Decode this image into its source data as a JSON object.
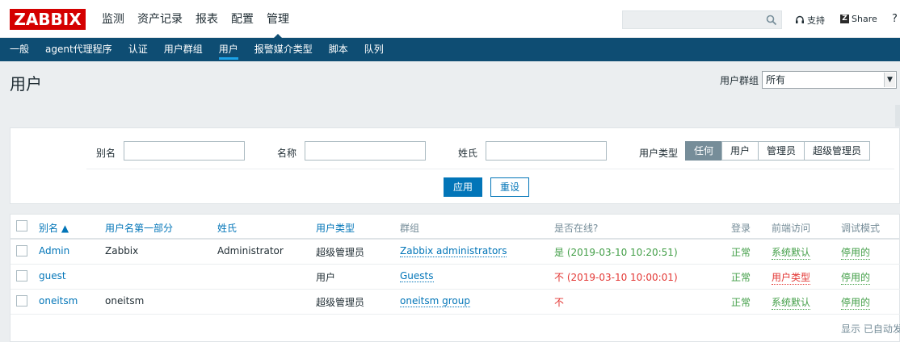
{
  "header": {
    "logo": "ZABBIX",
    "menu": [
      "监测",
      "资产记录",
      "报表",
      "配置",
      "管理"
    ],
    "selected_menu": 4,
    "search_placeholder": "",
    "support_label": "支持",
    "share_label": "Share",
    "share_icon_letter": "Z",
    "help_label": "?"
  },
  "subnav": {
    "items": [
      "一般",
      "agent代理程序",
      "认证",
      "用户群组",
      "用户",
      "报警媒介类型",
      "脚本",
      "队列"
    ],
    "selected": 4
  },
  "page": {
    "title": "用户",
    "group_filter_label": "用户群组",
    "group_filter_value": "所有"
  },
  "filter": {
    "alias_label": "别名",
    "name_label": "名称",
    "surname_label": "姓氏",
    "usertype_label": "用户类型",
    "usertype_options": [
      "任何",
      "用户",
      "管理员",
      "超级管理员"
    ],
    "usertype_selected": 0,
    "apply_label": "应用",
    "reset_label": "重设"
  },
  "table": {
    "columns": [
      "别名 ▲",
      "用户名第一部分",
      "姓氏",
      "用户类型",
      "群组",
      "是否在线?",
      "登录",
      "前端访问",
      "调试模式"
    ],
    "rows": [
      {
        "alias": "Admin",
        "name": "Zabbix",
        "surname": "Administrator",
        "type": "超级管理员",
        "groups": "Zabbix administrators",
        "online": "是 (2019-03-10 10:20:51)",
        "online_status": "yes",
        "login": "正常",
        "frontend": "系统默认",
        "frontend_status": "default",
        "debug": "停用的"
      },
      {
        "alias": "guest",
        "name": "",
        "surname": "",
        "type": "用户",
        "groups": "Guests",
        "online": "不 (2019-03-10 10:00:01)",
        "online_status": "no",
        "login": "正常",
        "frontend": "用户类型",
        "frontend_status": "usertype",
        "debug": "停用的"
      },
      {
        "alias": "oneitsm",
        "name": "oneitsm",
        "surname": "",
        "type": "超级管理员",
        "groups": "oneitsm group",
        "online": "不",
        "online_status": "no",
        "login": "正常",
        "frontend": "系统默认",
        "frontend_status": "default",
        "debug": "停用的"
      }
    ],
    "footer": "显示 已自动发"
  },
  "colors": {
    "brand_red": "#d40000",
    "nav_blue": "#0e4d73",
    "link_blue": "#0275b8",
    "green": "#429e47",
    "red": "#e33734"
  }
}
